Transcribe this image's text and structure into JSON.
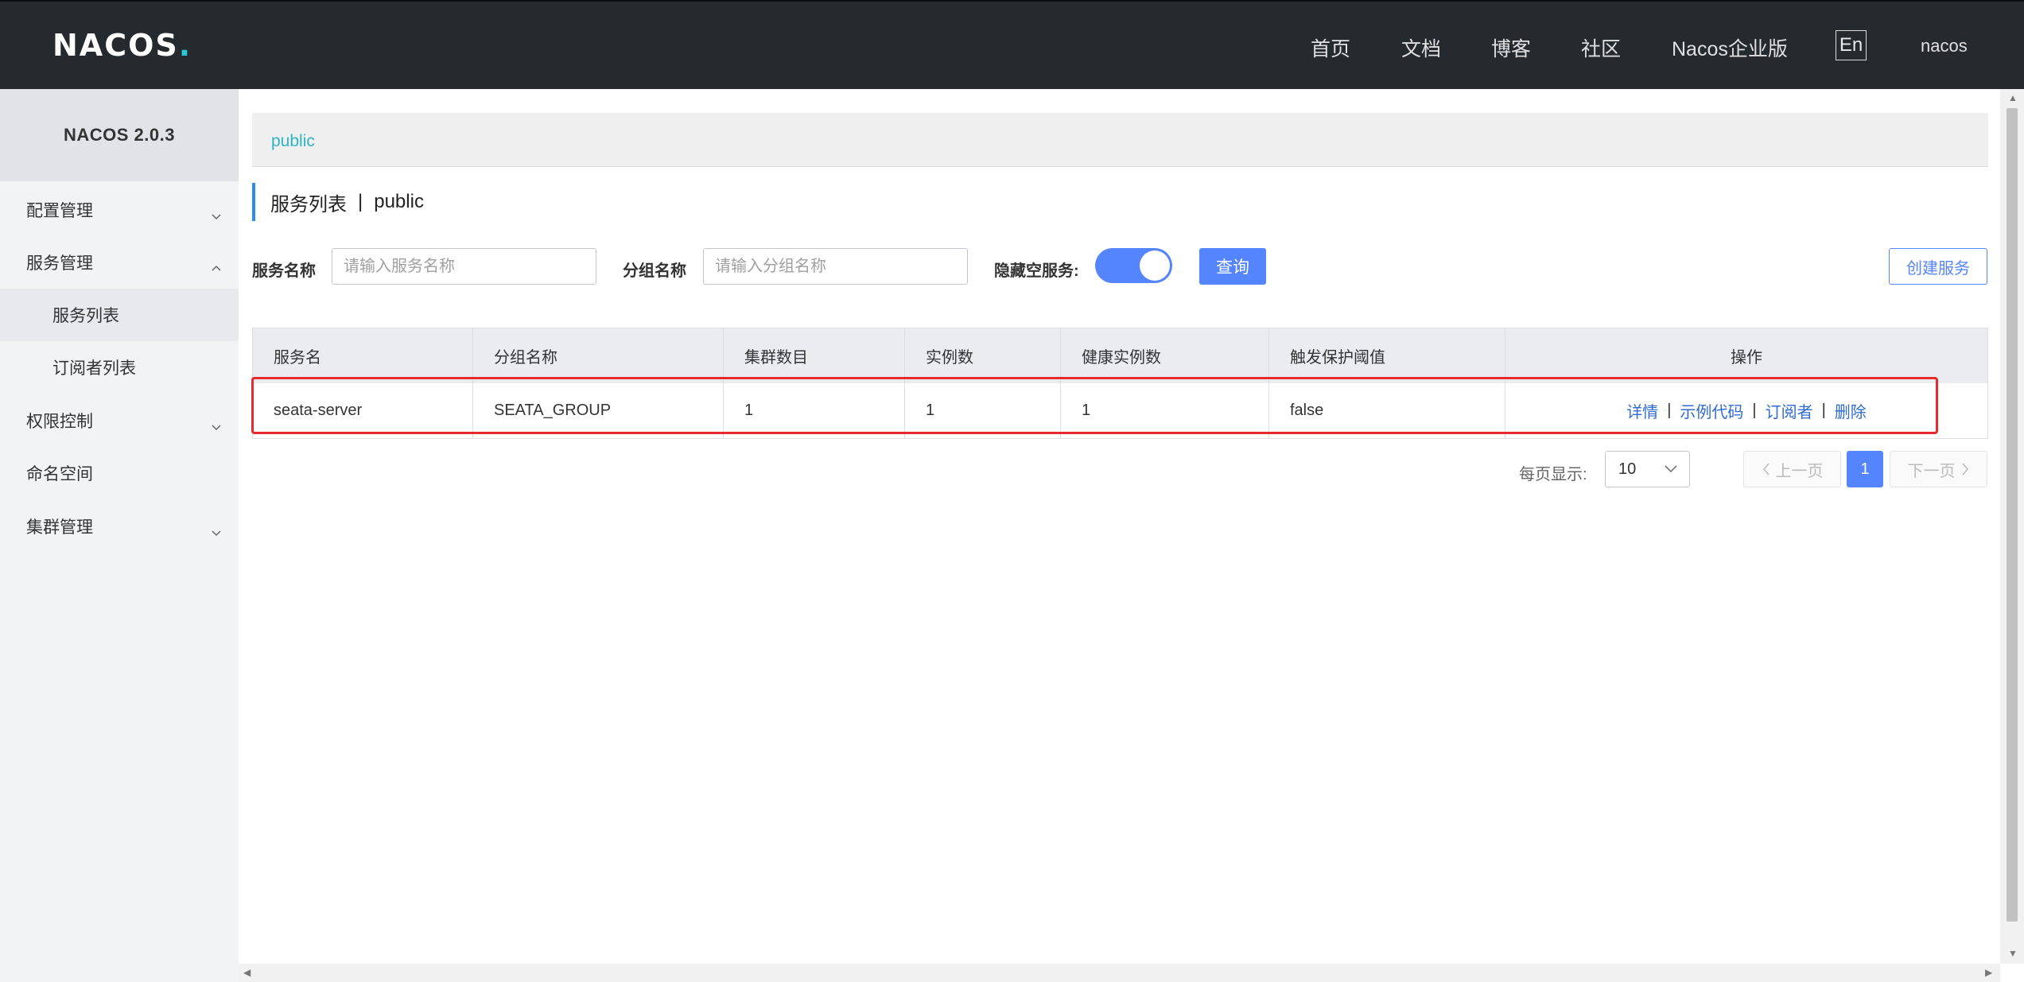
{
  "header": {
    "logo": "NACOS",
    "nav": [
      "首页",
      "文档",
      "博客",
      "社区",
      "Nacos企业版"
    ],
    "lang": "En",
    "user": "nacos"
  },
  "sidebar": {
    "version": "NACOS 2.0.3",
    "items": [
      {
        "label": "配置管理"
      },
      {
        "label": "服务管理"
      },
      {
        "label": "服务列表"
      },
      {
        "label": "订阅者列表"
      },
      {
        "label": "权限控制"
      },
      {
        "label": "命名空间"
      },
      {
        "label": "集群管理"
      }
    ]
  },
  "namespace": {
    "current": "public"
  },
  "page": {
    "title": "服务列表",
    "separator": "|",
    "namespace": "public"
  },
  "filters": {
    "service_name_label": "服务名称",
    "service_name_placeholder": "请输入服务名称",
    "group_name_label": "分组名称",
    "group_name_placeholder": "请输入分组名称",
    "hide_empty_label": "隐藏空服务:",
    "hide_empty_on": true,
    "query_button": "查询",
    "create_button": "创建服务"
  },
  "table": {
    "columns": [
      "服务名",
      "分组名称",
      "集群数目",
      "实例数",
      "健康实例数",
      "触发保护阈值",
      "操作"
    ],
    "rows": [
      {
        "service": "seata-server",
        "group": "SEATA_GROUP",
        "clusters": "1",
        "instances": "1",
        "healthy": "1",
        "threshold": "false",
        "actions": [
          "详情",
          "示例代码",
          "订阅者",
          "删除"
        ]
      }
    ]
  },
  "pagination": {
    "page_size_label": "每页显示:",
    "page_size": "10",
    "prev": "上一页",
    "current": "1",
    "next": "下一页"
  },
  "colors": {
    "topbar": "#252a2f",
    "primary": "#5584ff",
    "highlight": "#e82a2a",
    "link": "#2f6bd6"
  }
}
